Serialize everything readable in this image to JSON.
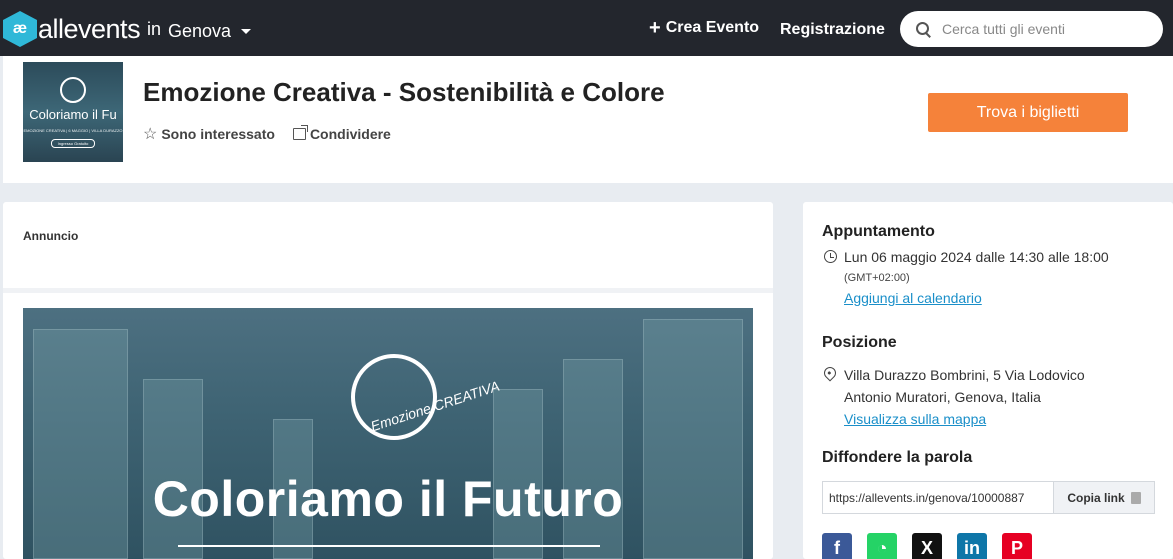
{
  "nav": {
    "logo_text": "allevents",
    "logo_glyph": "æ",
    "in_label": "in",
    "city": "Genova",
    "create_label": "Crea Evento",
    "register_label": "Registrazione",
    "search_placeholder": "Cerca tutti gli eventi"
  },
  "event": {
    "title": "Emozione Creativa - Sostenibilità e Colore",
    "interested_label": "Sono interessato",
    "share_label": "Condividere",
    "tickets_label": "Trova i biglietti",
    "thumbnail": {
      "title": "Coloriamo il Fu",
      "subtitle": "EMOZIONE CREATIVA | 6 MAGGIO | VILLA DURAZZO",
      "button": "Ingresso Gratuito"
    }
  },
  "content": {
    "ad_label": "Annuncio",
    "banner": {
      "emblem_text": "Emozione CREATIVA",
      "title": "Coloriamo il Futuro"
    }
  },
  "sidebar": {
    "schedule_heading": "Appuntamento",
    "date_text": "Lun 06 maggio 2024 dalle 14:30 alle 18:00",
    "timezone": "(GMT+02:00)",
    "calendar_link": "Aggiungi al calendario",
    "location_heading": "Posizione",
    "address_line1": "Villa Durazzo Bombrini, 5 Via Lodovico",
    "address_line2": "Antonio Muratori, Genova, Italia",
    "map_link": "Visualizza sulla mappa",
    "share_heading": "Diffondere la parola",
    "share_url": "https://allevents.in/genova/10000887",
    "copy_label": "Copia link",
    "social": [
      {
        "icon": "facebook-icon",
        "glyph": "f",
        "color": "#3b5998"
      },
      {
        "icon": "whatsapp-icon",
        "glyph": "◔",
        "color": "#25d366"
      },
      {
        "icon": "x-icon",
        "glyph": "X",
        "color": "#111111"
      },
      {
        "icon": "linkedin-icon",
        "glyph": "in",
        "color": "#0e76a8"
      },
      {
        "icon": "pinterest-icon",
        "glyph": "P",
        "color": "#e60023"
      }
    ]
  },
  "colors": {
    "topbar": "#23262d",
    "accent_orange": "#f5823a",
    "link_blue": "#1a8fc9",
    "logo_cyan": "#2fb8d8"
  }
}
